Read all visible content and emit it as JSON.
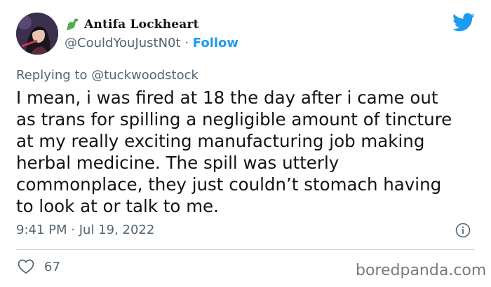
{
  "author": {
    "emoji_icon": "dinosaur-icon",
    "display_name": "Antifa Lockheart",
    "handle": "@CouldYouJustN0t",
    "separator": "·",
    "follow_label": "Follow"
  },
  "platform_icon": "twitter-bird-icon",
  "reply_to": {
    "prefix": "Replying to",
    "mention": "@tuckwoodstock"
  },
  "tweet_lines": [
    "I mean, i was fired at 18 the day after i came out",
    "as trans for spilling a negligible amount of tincture",
    "at my really exciting manufacturing job making",
    "herbal medicine. The spill was utterly",
    "commonplace, they just couldn’t stomach having",
    "to look at or talk to me."
  ],
  "timestamp": {
    "time": "9:41 PM",
    "separator": "·",
    "date": "Jul 19, 2022"
  },
  "likes": {
    "icon": "heart-icon",
    "count": "67"
  },
  "watermark": "boredpanda.com",
  "colors": {
    "accent": "#1d9bf0",
    "text": "#0f1419",
    "muted": "#536471",
    "dino": "#4caf50"
  }
}
